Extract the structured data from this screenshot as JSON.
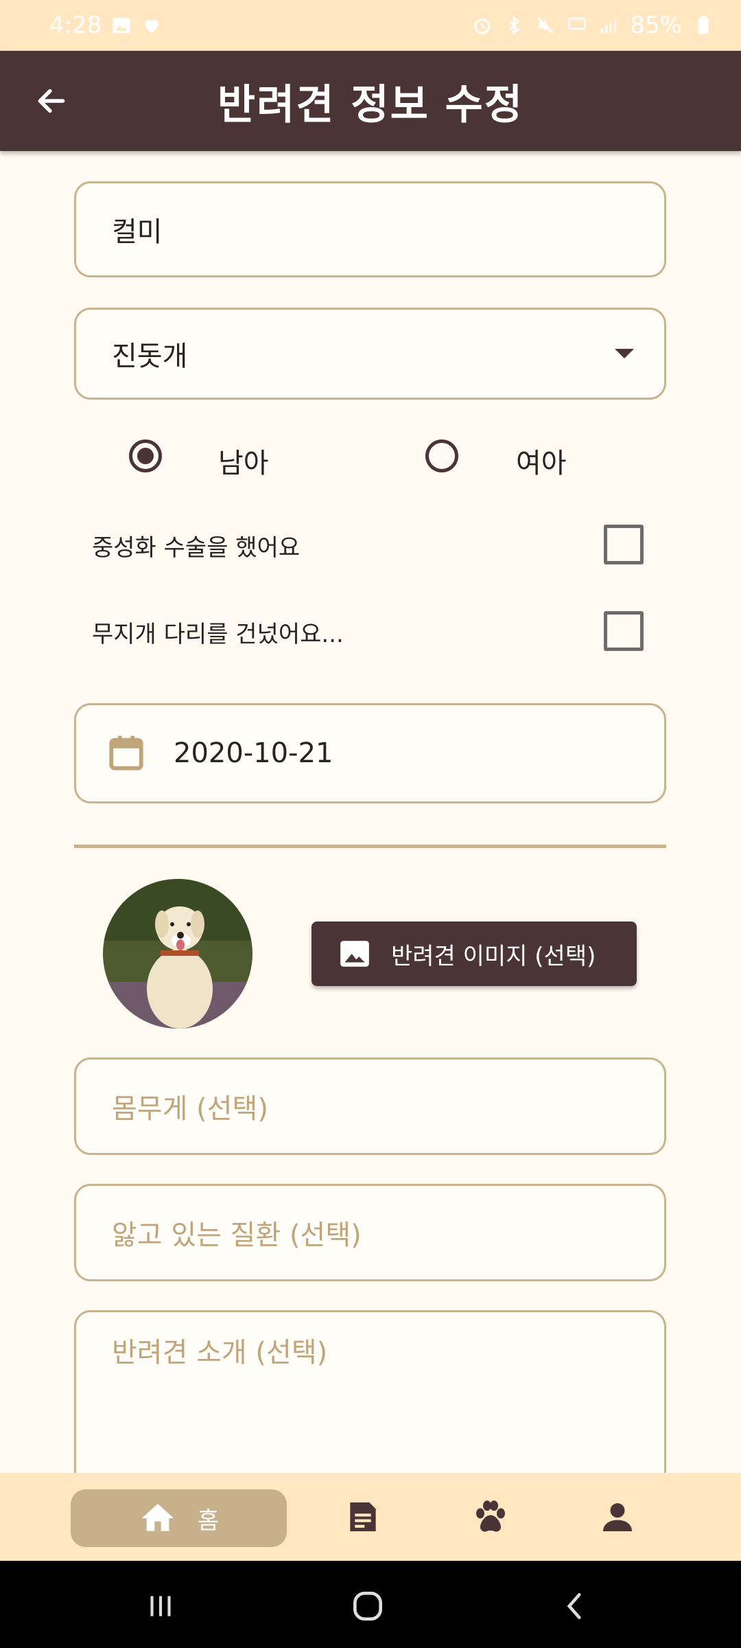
{
  "status_bar": {
    "time": "4:28",
    "battery": "85%"
  },
  "app_bar": {
    "title": "반려견 정보 수정"
  },
  "form": {
    "name_value": "컬미",
    "breed_value": "진돗개",
    "gender_options": [
      "남아",
      "여아"
    ],
    "gender_selected": "남아",
    "neutered_label": "중성화 수술을 했어요",
    "neutered_checked": false,
    "rainbow_label": "무지개 다리를 건넜어요...",
    "rainbow_checked": false,
    "birth_date": "2020-10-21",
    "image_button_label": "반려견 이미지 (선택)",
    "weight_placeholder": "몸무게 (선택)",
    "disease_placeholder": "앓고 있는 질환 (선택)",
    "intro_placeholder": "반려견 소개 (선택)"
  },
  "bottom_nav": {
    "home_label": "홈",
    "items": [
      "home-icon",
      "document-icon",
      "paw-icon",
      "person-icon"
    ]
  },
  "colors": {
    "primary": "#4a3435",
    "accent": "#c9b48e",
    "background": "#fffbf2",
    "bar": "#ffe7c2"
  }
}
